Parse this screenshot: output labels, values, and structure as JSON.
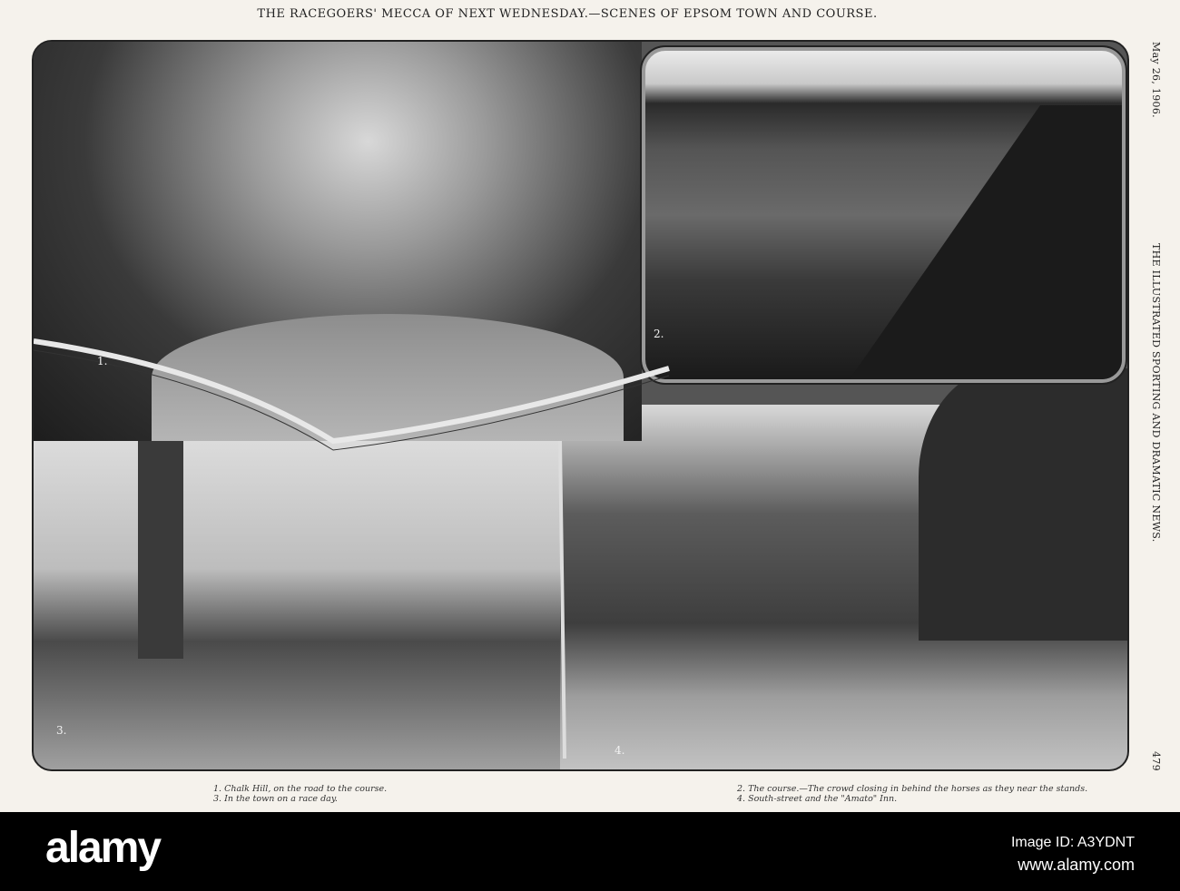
{
  "headline": "THE RACEGOERS' MECCA OF NEXT WEDNESDAY.—SCENES OF EPSOM TOWN AND COURSE.",
  "margin": {
    "date": "May 26, 1906.",
    "publication": "THE ILLUSTRATED SPORTING AND DRAMATIC NEWS.",
    "page_number": "479"
  },
  "photo_numbers": [
    "1.",
    "2.",
    "3.",
    "4."
  ],
  "captions": {
    "left": [
      "1. Chalk Hill, on the road to the course.",
      "3. In the town on a race day."
    ],
    "right": [
      "2. The course.—The crowd closing in behind the horses as they near the stands.",
      "4. South-street and the \"Amato\" Inn."
    ]
  },
  "footer": {
    "logo": "alamy",
    "image_id": "Image ID: A3YDNT",
    "url": "www.alamy.com"
  }
}
